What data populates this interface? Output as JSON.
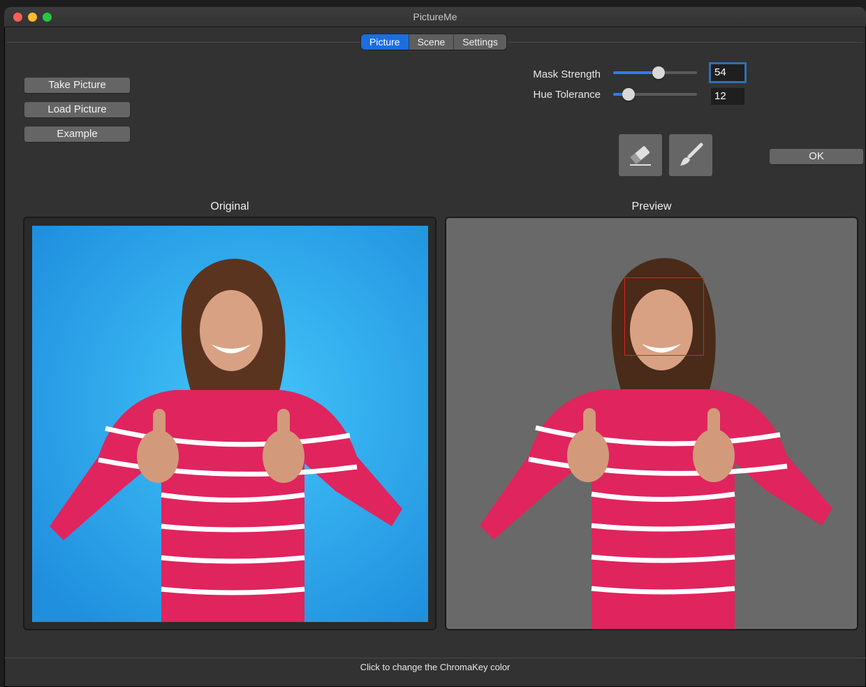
{
  "window": {
    "title": "PictureMe"
  },
  "tabs": [
    {
      "label": "Picture",
      "active": true
    },
    {
      "label": "Scene",
      "active": false
    },
    {
      "label": "Settings",
      "active": false
    }
  ],
  "actions": {
    "take_picture": "Take Picture",
    "load_picture": "Load Picture",
    "example": "Example",
    "ok": "OK"
  },
  "controls": {
    "mask_strength": {
      "label": "Mask Strength",
      "value": "54",
      "level": 0.54
    },
    "hue_tolerance": {
      "label": "Hue Tolerance",
      "value": "12",
      "level": 0.18
    }
  },
  "tools": [
    {
      "icon": "eraser-icon"
    },
    {
      "icon": "brush-icon"
    }
  ],
  "panels": {
    "original_label": "Original",
    "preview_label": "Preview"
  },
  "status": {
    "text": "Click to change the ChromaKey color"
  },
  "colors": {
    "accent": "#1b6ee0",
    "chroma_background": "#2aa8ea",
    "preview_background": "#696969",
    "face_box": "#e02020"
  }
}
